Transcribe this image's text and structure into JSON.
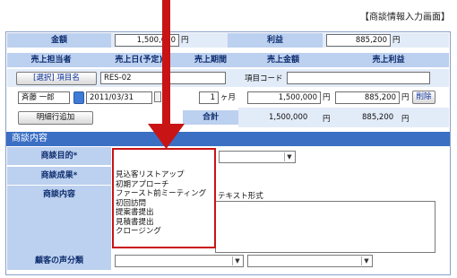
{
  "screen_title": "【商談情報入力画面】",
  "summary": {
    "amount_label": "金額",
    "amount_value": "1,500,000",
    "amount_unit": "円",
    "profit_label": "利益",
    "profit_value": "885,200",
    "profit_unit": "円"
  },
  "columns": {
    "sales_person": "売上担当者",
    "sales_date": "売上日(予定)",
    "sales_period": "売上期間",
    "sales_amount": "売上金額",
    "sales_profit": "売上利益"
  },
  "item_row": {
    "select_button": "[選択] 項目名",
    "item_name_value": "RES-02",
    "item_code_label": "項目コード",
    "item_code_value": ""
  },
  "detail_row": {
    "person": "斉藤 一郎",
    "date": "2011/03/31",
    "months": "1",
    "months_unit": "ヶ月",
    "amount": "1,500,000",
    "amount_unit": "円",
    "profit": "885,200",
    "profit_unit": "円",
    "delete_label": "削除"
  },
  "totals": {
    "add_row_button": "明細行追加",
    "total_label": "合計",
    "amount": "1,500,000",
    "amount_unit": "円",
    "profit": "885,200",
    "profit_unit": "円"
  },
  "section": {
    "title": "商談内容",
    "purpose_label": "商談目的*",
    "result_label": "商談成果*",
    "content_label": "商談内容",
    "text_format_label": "テキスト形式",
    "voice_label": "顧客の声分類"
  },
  "purpose_options": [
    "見込客リストアップ",
    "初期アプローチ",
    "ファースト前ミーティング",
    "初回訪問",
    "提案書提出",
    "見積書提出",
    "クロージング"
  ]
}
